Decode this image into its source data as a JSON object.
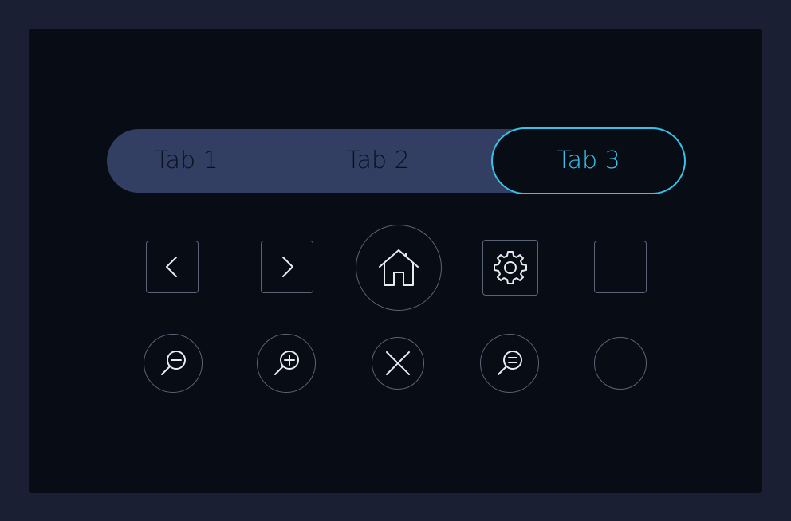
{
  "tabs": [
    {
      "label": "Tab 1",
      "active": false
    },
    {
      "label": "Tab 2",
      "active": false
    },
    {
      "label": "Tab 3",
      "active": true
    }
  ],
  "colors": {
    "background": "#1a1f33",
    "panel": "#080c14",
    "tab_bar": "#323f63",
    "accent": "#36c3ea",
    "icon_stroke": "#e8ebf2",
    "button_border": "#5b6378"
  },
  "icons": {
    "row1": [
      "chevron-left-icon",
      "chevron-right-icon",
      "home-icon",
      "gear-icon",
      "empty-square"
    ],
    "row2": [
      "zoom-out-icon",
      "zoom-in-icon",
      "close-icon",
      "search-equal-icon",
      "empty-circle"
    ]
  }
}
